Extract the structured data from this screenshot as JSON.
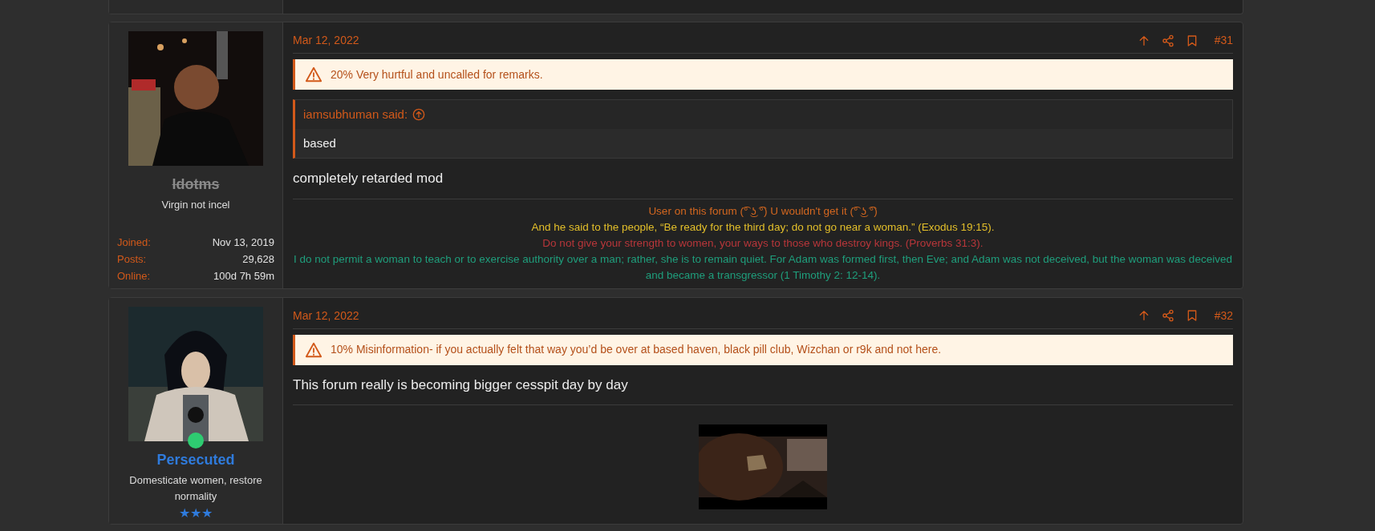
{
  "posts": [
    {
      "user": {
        "name": "Idotms",
        "banned": true,
        "online": false,
        "title": "Virgin not incel",
        "stats": [
          {
            "label": "Joined:",
            "value": "Nov 13, 2019"
          },
          {
            "label": "Posts:",
            "value": "29,628"
          },
          {
            "label": "Online:",
            "value": "100d 7h 59m"
          }
        ]
      },
      "date": "Mar 12, 2022",
      "number": "#31",
      "warning": "20% Very hurtful and uncalled for remarks.",
      "quote": {
        "author": "iamsubhuman said:",
        "text": "based"
      },
      "message": "completely retarded mod",
      "signature": [
        {
          "text": "User on this forum (͡° ͜ʖ ͡°) U wouldn't get it (͡° ͜ʖ ͡°)",
          "color": "#d4671f"
        },
        {
          "text": "And he said to the people, “Be ready for the third day; do not go near a woman.” (Exodus 19:15).",
          "color": "#e3bf2a"
        },
        {
          "text": "Do not give your strength to women, your ways to those who destroy kings. (Proverbs 31:3).",
          "color": "#b8363a"
        },
        {
          "text": "I do not permit a woman to teach or to exercise authority over a man; rather, she is to remain quiet. For Adam was formed first, then Eve; and Adam was not deceived, but the woman was deceived and became a transgressor (1 Timothy 2: 12-14).",
          "color": "#1f9e7c"
        }
      ]
    },
    {
      "user": {
        "name": "Persecuted",
        "banned": false,
        "online": true,
        "title": "Domesticate women, restore normality",
        "stars": 3
      },
      "date": "Mar 12, 2022",
      "number": "#32",
      "warning": "10% Misinformation- if you actually felt that way you’d be over at based haven, black pill club, Wizchan or r9k and not here.",
      "message": "This forum really is becoming bigger cesspit day by day"
    }
  ]
}
